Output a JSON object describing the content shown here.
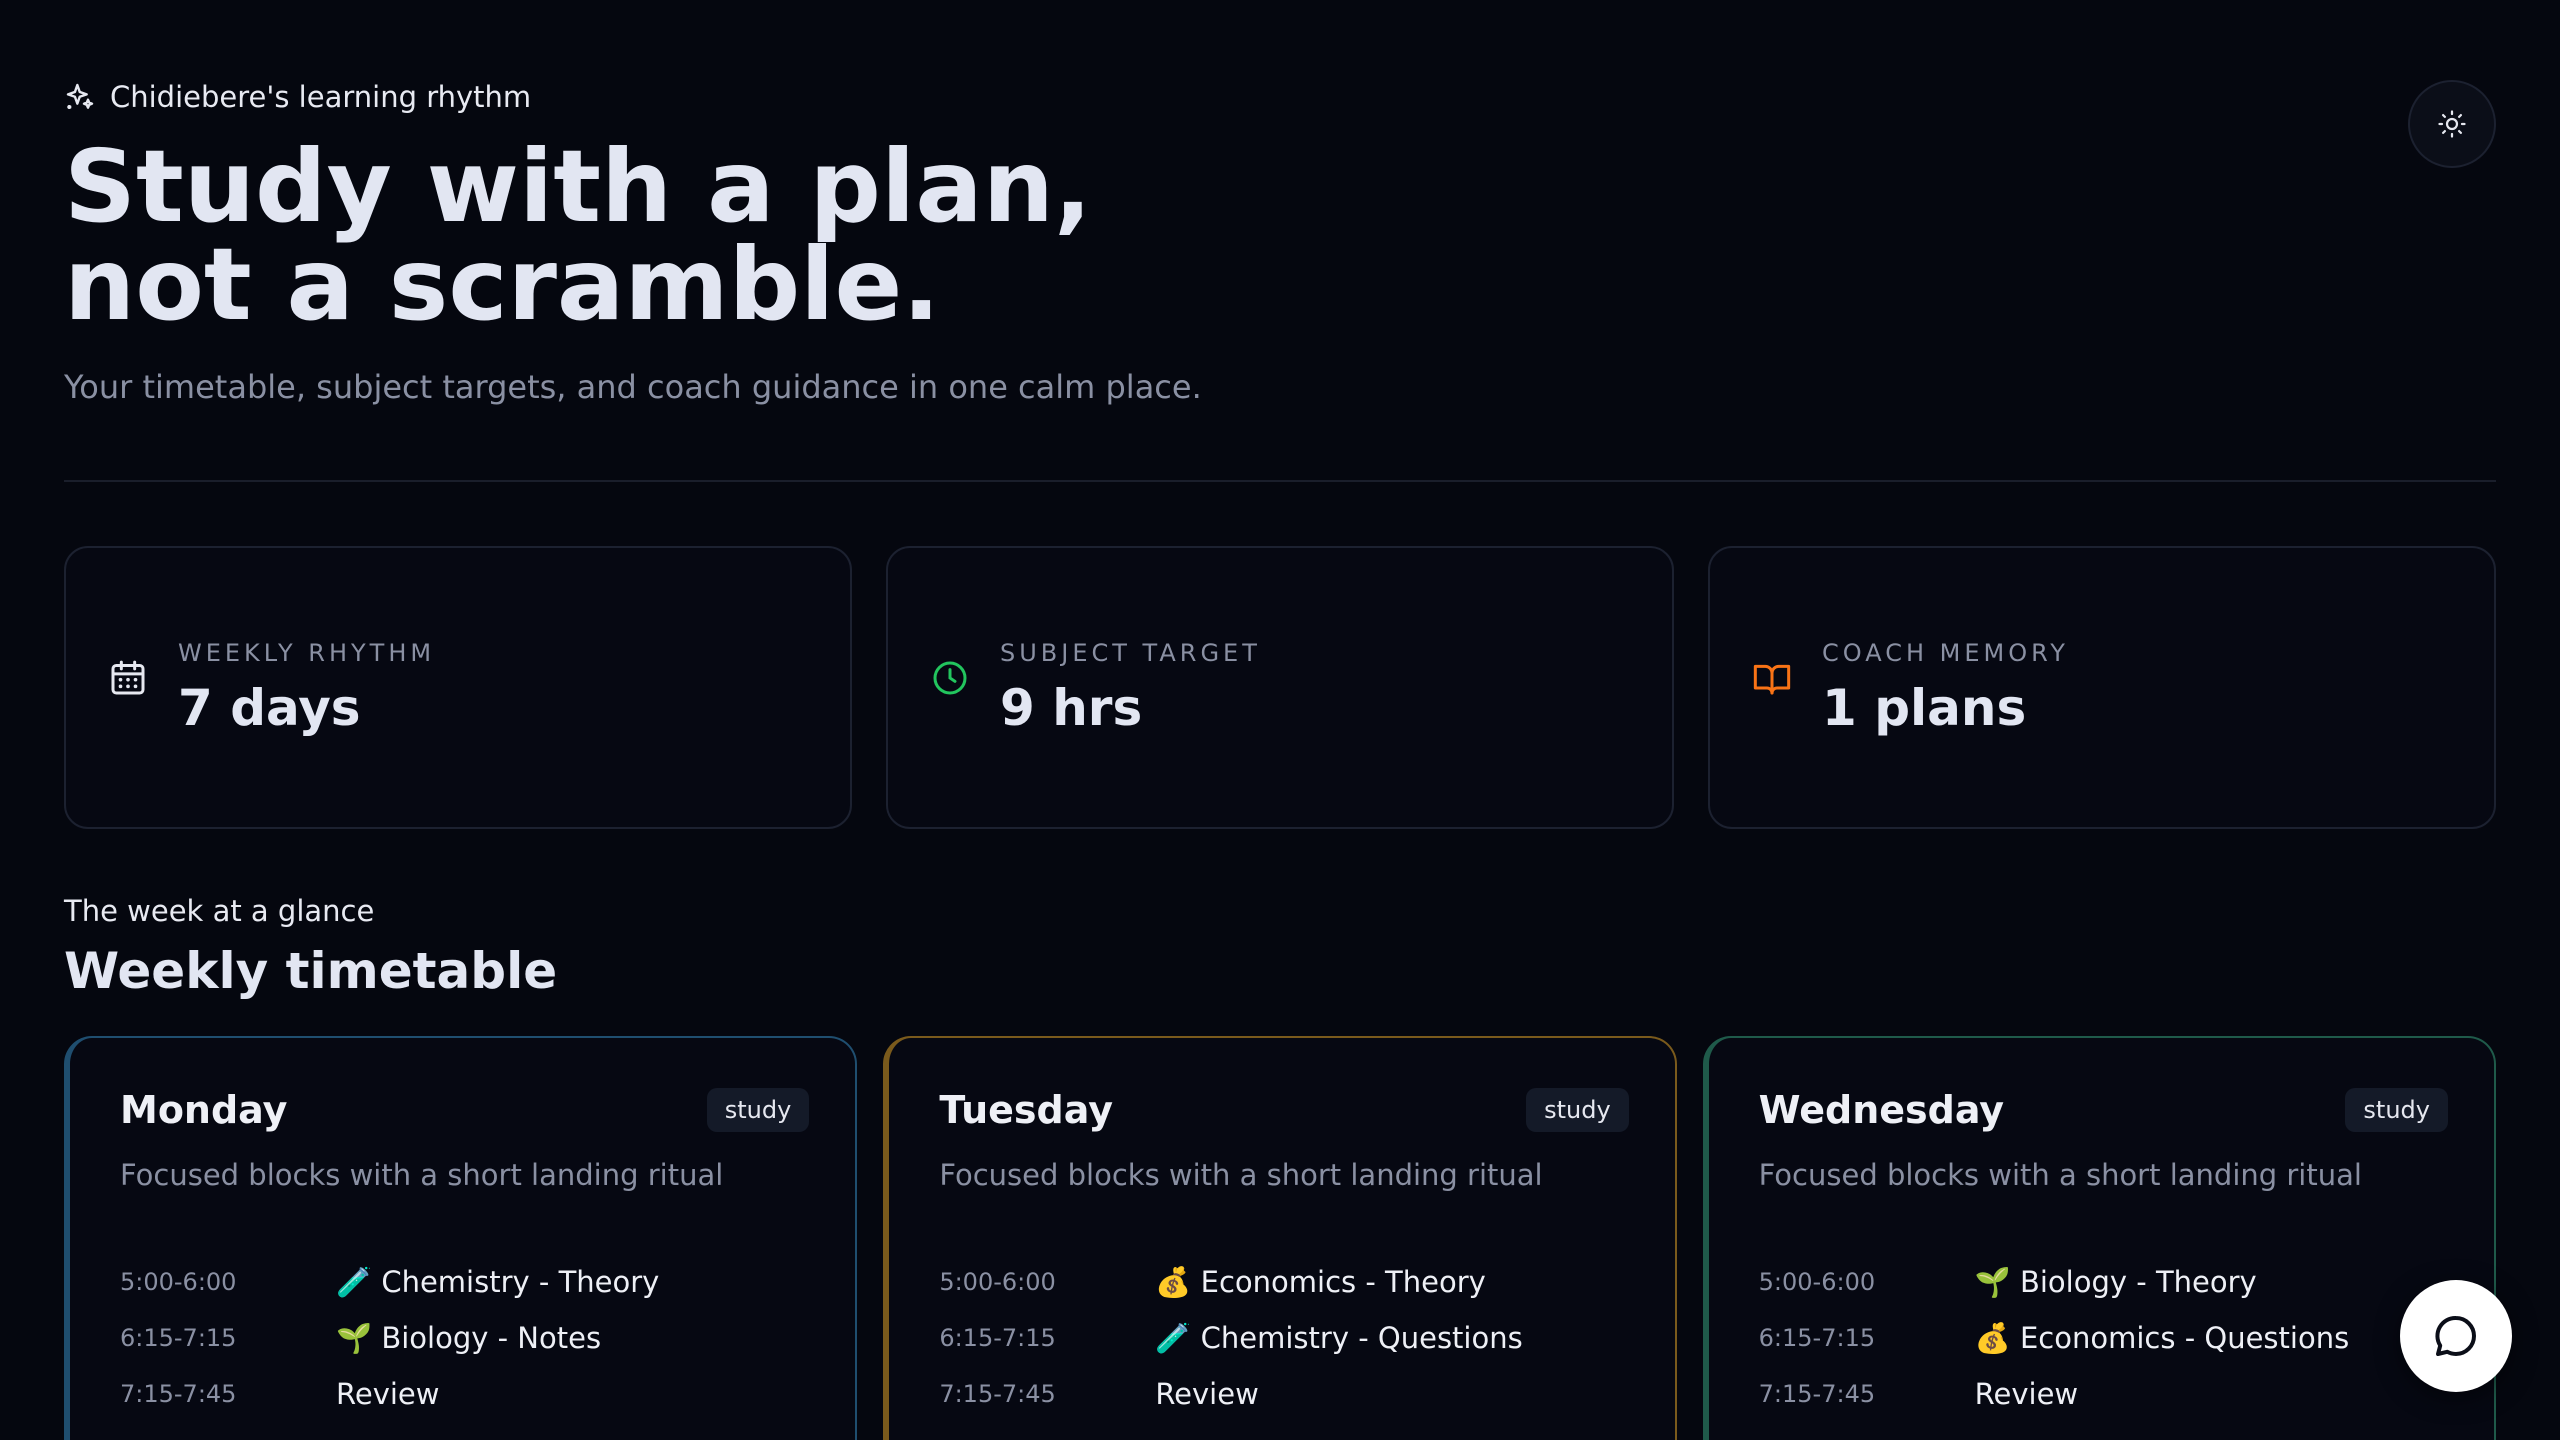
{
  "header": {
    "eyebrow": "Chidiebere's learning rhythm",
    "title_line1": "Study with a plan,",
    "title_line2": "not a scramble.",
    "subtitle": "Your timetable, subject targets, and coach guidance in one calm place."
  },
  "stats": [
    {
      "label": "WEEKLY RHYTHM",
      "value": "7 days",
      "icon": "calendar-icon",
      "color": "#e6e8f0"
    },
    {
      "label": "SUBJECT TARGET",
      "value": "9 hrs",
      "icon": "clock-icon",
      "color": "#22c55e"
    },
    {
      "label": "COACH MEMORY",
      "value": "1 plans",
      "icon": "book-icon",
      "color": "#f97316"
    }
  ],
  "weekly": {
    "eyebrow": "The week at a glance",
    "title": "Weekly timetable",
    "days": [
      {
        "name": "Monday",
        "tag": "study",
        "desc": "Focused blocks with a short landing ritual",
        "accent": "#1f4e6f",
        "slots": [
          {
            "time": "5:00-6:00",
            "subject": "🧪 Chemistry - Theory"
          },
          {
            "time": "6:15-7:15",
            "subject": "🌱 Biology - Notes"
          },
          {
            "time": "7:15-7:45",
            "subject": "Review"
          }
        ]
      },
      {
        "name": "Tuesday",
        "tag": "study",
        "desc": "Focused blocks with a short landing ritual",
        "accent": "#7a5a1c",
        "slots": [
          {
            "time": "5:00-6:00",
            "subject": "💰 Economics - Theory"
          },
          {
            "time": "6:15-7:15",
            "subject": "🧪 Chemistry - Questions"
          },
          {
            "time": "7:15-7:45",
            "subject": "Review"
          }
        ]
      },
      {
        "name": "Wednesday",
        "tag": "study",
        "desc": "Focused blocks with a short landing ritual",
        "accent": "#1f5a4a",
        "slots": [
          {
            "time": "5:00-6:00",
            "subject": "🌱 Biology - Theory"
          },
          {
            "time": "6:15-7:15",
            "subject": "💰 Economics - Questions"
          },
          {
            "time": "7:15-7:45",
            "subject": "Review"
          }
        ]
      }
    ]
  },
  "icons": {
    "eyebrow": "sparkles-icon",
    "theme_toggle": "sun-icon",
    "chat": "chat-bubble-icon"
  }
}
